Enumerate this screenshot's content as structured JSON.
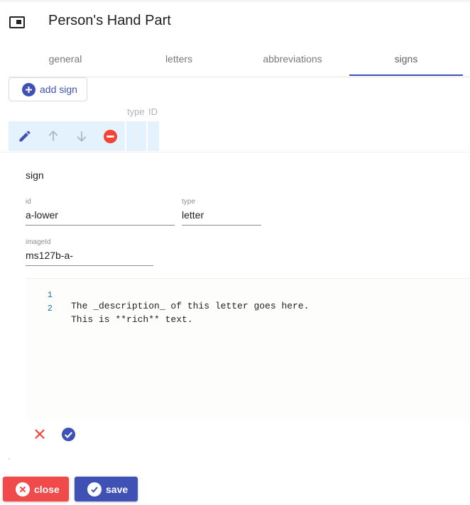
{
  "header": {
    "title": "Person's Hand Part",
    "icon": "window-icon"
  },
  "tabs": [
    {
      "label": "general",
      "active": false
    },
    {
      "label": "letters",
      "active": false
    },
    {
      "label": "abbreviations",
      "active": false
    },
    {
      "label": "signs",
      "active": true
    }
  ],
  "toolbar": {
    "add_sign_label": "add sign"
  },
  "table": {
    "columns": [
      "type",
      "ID"
    ],
    "row_actions": [
      "edit-icon",
      "move-up-icon",
      "move-down-icon",
      "remove-icon"
    ]
  },
  "sign_editor": {
    "section_label": "sign",
    "fields": {
      "id": {
        "label": "id",
        "value": "a-lower"
      },
      "type": {
        "label": "type",
        "value": "letter"
      },
      "imageId": {
        "label": "imageId",
        "value": "ms127b-a-"
      }
    },
    "description_lines": [
      {
        "number": "1",
        "text": "The _description_ of this letter goes here."
      },
      {
        "number": "2",
        "text": "This is **rich** text."
      }
    ]
  },
  "footer": {
    "close_label": "close",
    "save_label": "save"
  },
  "colors": {
    "primary": "#3f51b5",
    "danger": "#f04a4a",
    "row_highlight": "#e3f2fc"
  }
}
